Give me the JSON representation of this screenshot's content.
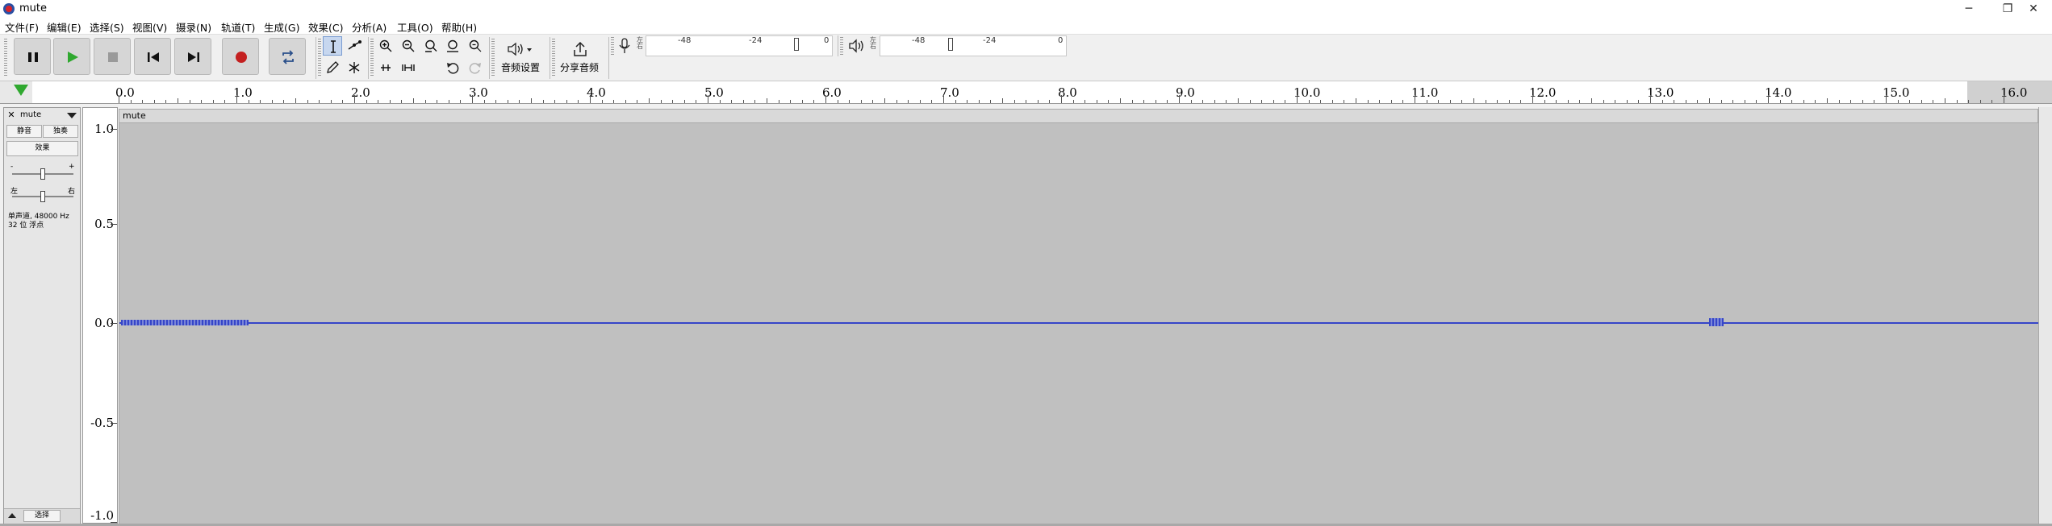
{
  "window": {
    "title": "mute",
    "minimize": "─",
    "restore": "❐",
    "close": "✕"
  },
  "menu": [
    "文件(F)",
    "编辑(E)",
    "选择(S)",
    "视图(V)",
    "摄录(N)",
    "轨道(T)",
    "生成(G)",
    "效果(C)",
    "分析(A)",
    "工具(O)",
    "帮助(H)"
  ],
  "toolbar": {
    "audio_setup_label": "音频设置",
    "share_audio_label": "分享音频",
    "rec_meter_lr": "左右",
    "play_meter_lr": "左右",
    "rec_meter_ticks": [
      "-48",
      "-24",
      "0"
    ],
    "play_meter_ticks": [
      "-48",
      "-24",
      "0"
    ]
  },
  "ruler": {
    "labels": [
      "0.0",
      "1.0",
      "2.0",
      "3.0",
      "4.0",
      "5.0",
      "6.0",
      "7.0",
      "8.0",
      "9.0",
      "10.0",
      "11.0",
      "12.0",
      "13.0",
      "14.0",
      "15.0",
      "16.0"
    ]
  },
  "track": {
    "name": "mute",
    "mute_label": "静音",
    "solo_label": "独奏",
    "effects_label": "效果",
    "gain_minus": "-",
    "gain_plus": "+",
    "pan_left": "左",
    "pan_right": "右",
    "info_line1": "单声道, 48000 Hz",
    "info_line2": "32 位 浮点",
    "select_label": "选择",
    "clip_name": "mute",
    "amplitude_labels": [
      "1.0",
      "0.5",
      "0.0",
      "-0.5",
      "-1.0"
    ]
  },
  "colors": {
    "waveform": "#3545c8",
    "track_bg": "#c0c0c0",
    "play_green": "#2fa82f",
    "record_red": "#c42020"
  }
}
